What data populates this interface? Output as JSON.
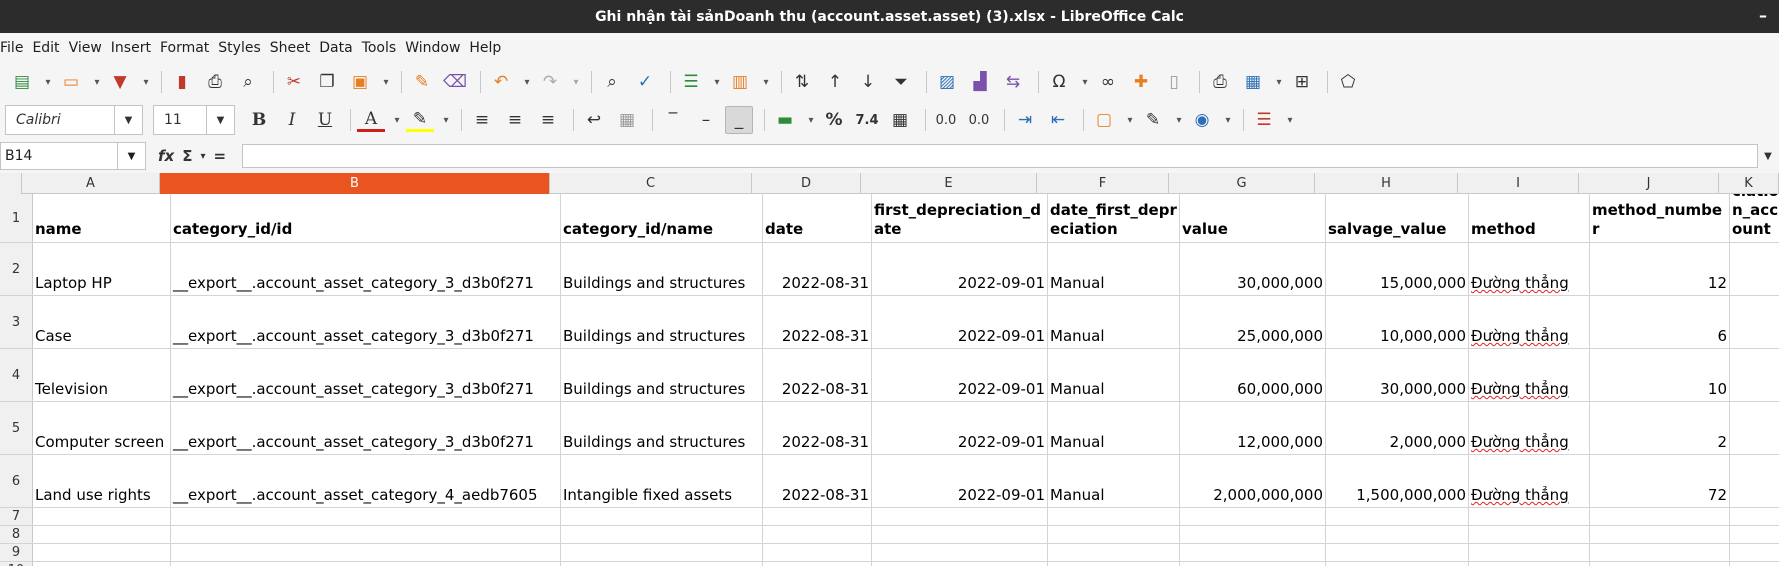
{
  "window": {
    "title": "Ghi nhận tài sảnDoanh thu (account.asset.asset) (3).xlsx - LibreOffice Calc",
    "minimize_glyph": "–"
  },
  "menu": [
    "File",
    "Edit",
    "View",
    "Insert",
    "Format",
    "Styles",
    "Sheet",
    "Data",
    "Tools",
    "Window",
    "Help"
  ],
  "format_toolbar": {
    "font_name": "Calibri",
    "font_size": "11",
    "bold": "B",
    "italic": "I",
    "underline": "U",
    "font_color_label": "A",
    "percent": "%",
    "number_format": "7.4",
    "add_decimal": "0.0",
    "del_decimal": "0.0"
  },
  "formula_bar": {
    "name_box": "B14",
    "fx": "fx",
    "sum": "Σ",
    "equals": "=",
    "content": ""
  },
  "columns": [
    {
      "letter": "A",
      "width": 138
    },
    {
      "letter": "B",
      "width": 390,
      "active": true
    },
    {
      "letter": "C",
      "width": 202
    },
    {
      "letter": "D",
      "width": 109
    },
    {
      "letter": "E",
      "width": 176
    },
    {
      "letter": "F",
      "width": 132
    },
    {
      "letter": "G",
      "width": 146
    },
    {
      "letter": "H",
      "width": 143
    },
    {
      "letter": "I",
      "width": 121
    },
    {
      "letter": "J",
      "width": 140
    },
    {
      "letter": "K",
      "width": 60
    }
  ],
  "rows": [
    {
      "num": "1",
      "height": 49,
      "header": true,
      "cells": [
        "name",
        "category_id/id",
        "category_id/name",
        "date",
        "first_depreciation_date",
        "date_first_depreciation",
        "value",
        "salvage_value",
        "method",
        "method_number",
        "depreciation_account"
      ]
    },
    {
      "num": "2",
      "height": 53,
      "cells": [
        "Laptop HP",
        "__export__.account_asset_category_3_d3b0f271",
        "Buildings and structures",
        "2022-08-31",
        "2022-09-01",
        "Manual",
        "30,000,000",
        "15,000,000",
        "Đường thẳng",
        "12",
        ""
      ]
    },
    {
      "num": "3",
      "height": 53,
      "cells": [
        "Case",
        "__export__.account_asset_category_3_d3b0f271",
        "Buildings and structures",
        "2022-08-31",
        "2022-09-01",
        "Manual",
        "25,000,000",
        "10,000,000",
        "Đường thẳng",
        "6",
        ""
      ]
    },
    {
      "num": "4",
      "height": 53,
      "cells": [
        "Television",
        "__export__.account_asset_category_3_d3b0f271",
        "Buildings and structures",
        "2022-08-31",
        "2022-09-01",
        "Manual",
        "60,000,000",
        "30,000,000",
        "Đường thẳng",
        "10",
        ""
      ]
    },
    {
      "num": "5",
      "height": 53,
      "cells": [
        "Computer screen",
        "__export__.account_asset_category_3_d3b0f271",
        "Buildings and structures",
        "2022-08-31",
        "2022-09-01",
        "Manual",
        "12,000,000",
        "2,000,000",
        "Đường thẳng",
        "2",
        ""
      ]
    },
    {
      "num": "6",
      "height": 53,
      "cells": [
        "Land use rights",
        "__export__.account_asset_category_4_aedb7605",
        "Intangible fixed assets",
        "2022-08-31",
        "2022-09-01",
        "Manual",
        "2,000,000,000",
        "1,500,000,000",
        "Đường thẳng",
        "72",
        ""
      ]
    },
    {
      "num": "7",
      "height": 18,
      "cells": [
        "",
        "",
        "",
        "",
        "",
        "",
        "",
        "",
        "",
        "",
        ""
      ]
    },
    {
      "num": "8",
      "height": 18,
      "cells": [
        "",
        "",
        "",
        "",
        "",
        "",
        "",
        "",
        "",
        "",
        ""
      ]
    },
    {
      "num": "9",
      "height": 18,
      "cells": [
        "",
        "",
        "",
        "",
        "",
        "",
        "",
        "",
        "",
        "",
        ""
      ]
    },
    {
      "num": "10",
      "height": 18,
      "cells": [
        "",
        "",
        "",
        "",
        "",
        "",
        "",
        "",
        "",
        "",
        ""
      ]
    }
  ],
  "numeric_columns": [
    3,
    4,
    6,
    7,
    9
  ]
}
